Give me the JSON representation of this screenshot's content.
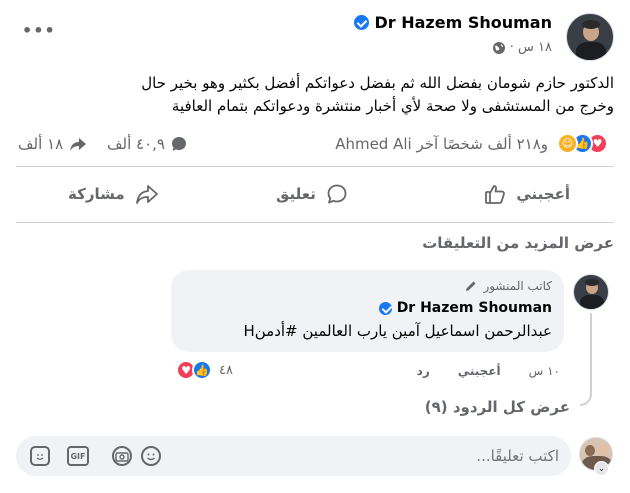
{
  "post": {
    "author": "Dr Hazem Shouman",
    "time": "١٨ س ·",
    "body_line1": "الدكتور حازم شومان بفضل الله ثم بفضل دعواتكم أفضل بكثير وهو بخير حال",
    "body_line2": "وخرج من المستشفى ولا صحة لأي أخبار منتشرة  ودعواتكم بتمام العافية",
    "reactions_text": "Ahmed Ali و٢١٨ ألف شخصًا آخر",
    "comments_count": "٤٠,٩ ألف",
    "shares_count": "١٨ ألف",
    "more_label": "•••"
  },
  "actions": {
    "like": "أعجبني",
    "comment": "تعليق",
    "share": "مشاركة"
  },
  "comments_section": {
    "view_more": "عرض المزيد من التعليقات",
    "comment": {
      "author_badge": "كاتب المنشور",
      "author": "Dr Hazem Shouman",
      "text": "عبدالرحمن اسماعيل آمين يارب العالمين #أدمنH",
      "time": "١٠ س",
      "like": "أعجبني",
      "reply": "رد",
      "reactions_count": "٤٨"
    },
    "view_replies": "عرض كل الردود (٩)"
  },
  "composer": {
    "placeholder": "اكتب تعليقًا..."
  },
  "colors": {
    "verified": "#1877f2",
    "love": "#f33e58",
    "like": "#1877f2",
    "care": "#f7b125"
  }
}
